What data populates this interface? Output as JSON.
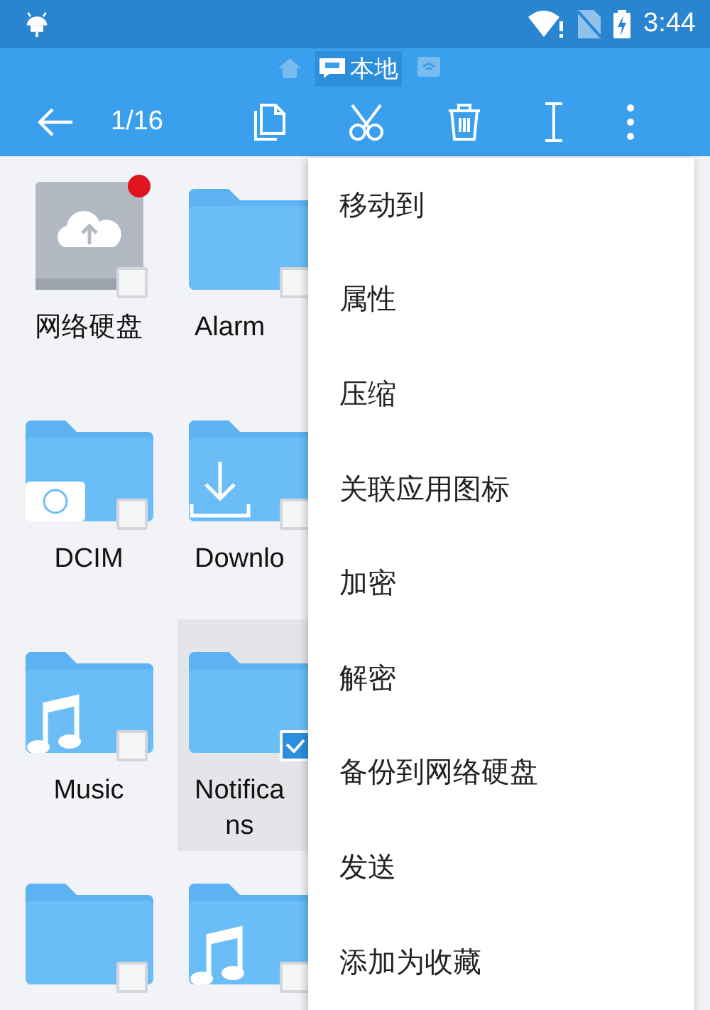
{
  "status_bar": {
    "time": "3:44"
  },
  "path_bar": {
    "items": [
      {
        "kind": "home",
        "selected": false
      },
      {
        "kind": "sd",
        "label": "本地",
        "selected": true
      },
      {
        "kind": "network",
        "selected": false
      }
    ]
  },
  "toolbar": {
    "counter": "1/16"
  },
  "files": [
    {
      "name_lines": [
        "网络硬盘"
      ],
      "kind": "cloud",
      "badge": true,
      "checked": false,
      "selected": false
    },
    {
      "name_lines": [
        "Alarm"
      ],
      "kind": "plain",
      "badge": false,
      "checked": false,
      "selected": false
    },
    {
      "name_lines": [
        "DCIM"
      ],
      "kind": "camera",
      "badge": false,
      "checked": false,
      "selected": false
    },
    {
      "name_lines": [
        "Downlo"
      ],
      "kind": "download",
      "badge": false,
      "checked": false,
      "selected": false
    },
    {
      "name_lines": [
        "Music"
      ],
      "kind": "music",
      "badge": false,
      "checked": false,
      "selected": false
    },
    {
      "name_lines": [
        "Notifica",
        "ns"
      ],
      "kind": "plain",
      "badge": false,
      "checked": true,
      "selected": true
    },
    {
      "kind": "plain",
      "badge": false,
      "checked": false,
      "selected": false
    },
    {
      "kind": "music",
      "badge": false,
      "checked": false,
      "selected": false
    }
  ],
  "menu": {
    "items": [
      "移动到",
      "属性",
      "压缩",
      "关联应用图标",
      "加密",
      "解密",
      "备份到网络硬盘",
      "发送",
      "添加为收藏"
    ]
  }
}
